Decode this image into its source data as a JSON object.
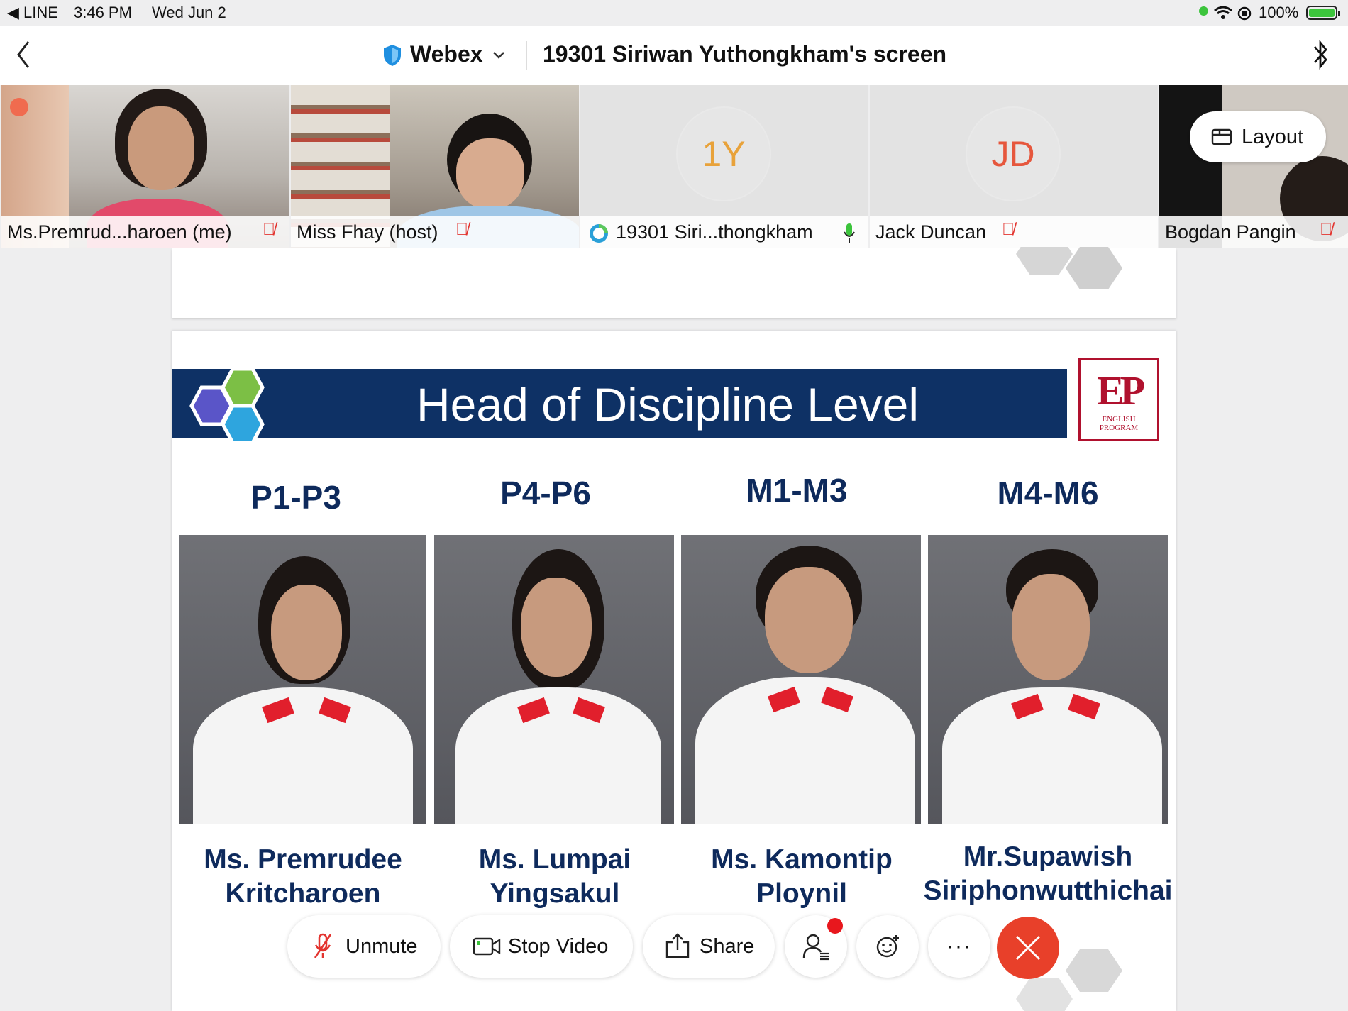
{
  "status_bar": {
    "back_app": "◀ LINE",
    "time": "3:46 PM",
    "date": "Wed Jun 2",
    "battery": "100%"
  },
  "header": {
    "app_name": "Webex",
    "screen_title": "19301 Siriwan Yuthongkham's screen"
  },
  "participants": [
    {
      "name": "Ms.Premrud...haroen (me)",
      "mic": "muted"
    },
    {
      "name": "Miss Fhay (host)",
      "mic": "muted"
    },
    {
      "name": "19301 Siri...thongkham",
      "initials": "1Y",
      "mic": "active"
    },
    {
      "name": "Jack Duncan",
      "initials": "JD",
      "mic": "muted"
    },
    {
      "name": "Bogdan Pangin",
      "mic": "muted"
    }
  ],
  "layout_button": "Layout",
  "slide": {
    "title": "Head of Discipline Level",
    "logo_text": "EP",
    "logo_sub": [
      "ENGLISH",
      "PROGRAM"
    ],
    "columns": [
      {
        "level": "P1-P3",
        "name_line1": "Ms. Premrudee",
        "name_line2": "Kritcharoen"
      },
      {
        "level": "P4-P6",
        "name_line1": "Ms. Lumpai",
        "name_line2": "Yingsakul"
      },
      {
        "level": "M1-M3",
        "name_line1": "Ms. Kamontip",
        "name_line2": "Ploynil"
      },
      {
        "level": "M4-M6",
        "name_line1": "Mr.Supawish",
        "name_line2": "Siriphonwutthichai"
      }
    ]
  },
  "toolbar": {
    "unmute": "Unmute",
    "stop_video": "Stop Video",
    "share": "Share",
    "more": "···"
  },
  "colors": {
    "navy": "#0e3165",
    "end_call": "#e8402a",
    "mute_red": "#e3342f",
    "mic_green": "#3cc43c",
    "logo_red": "#b0112e"
  }
}
